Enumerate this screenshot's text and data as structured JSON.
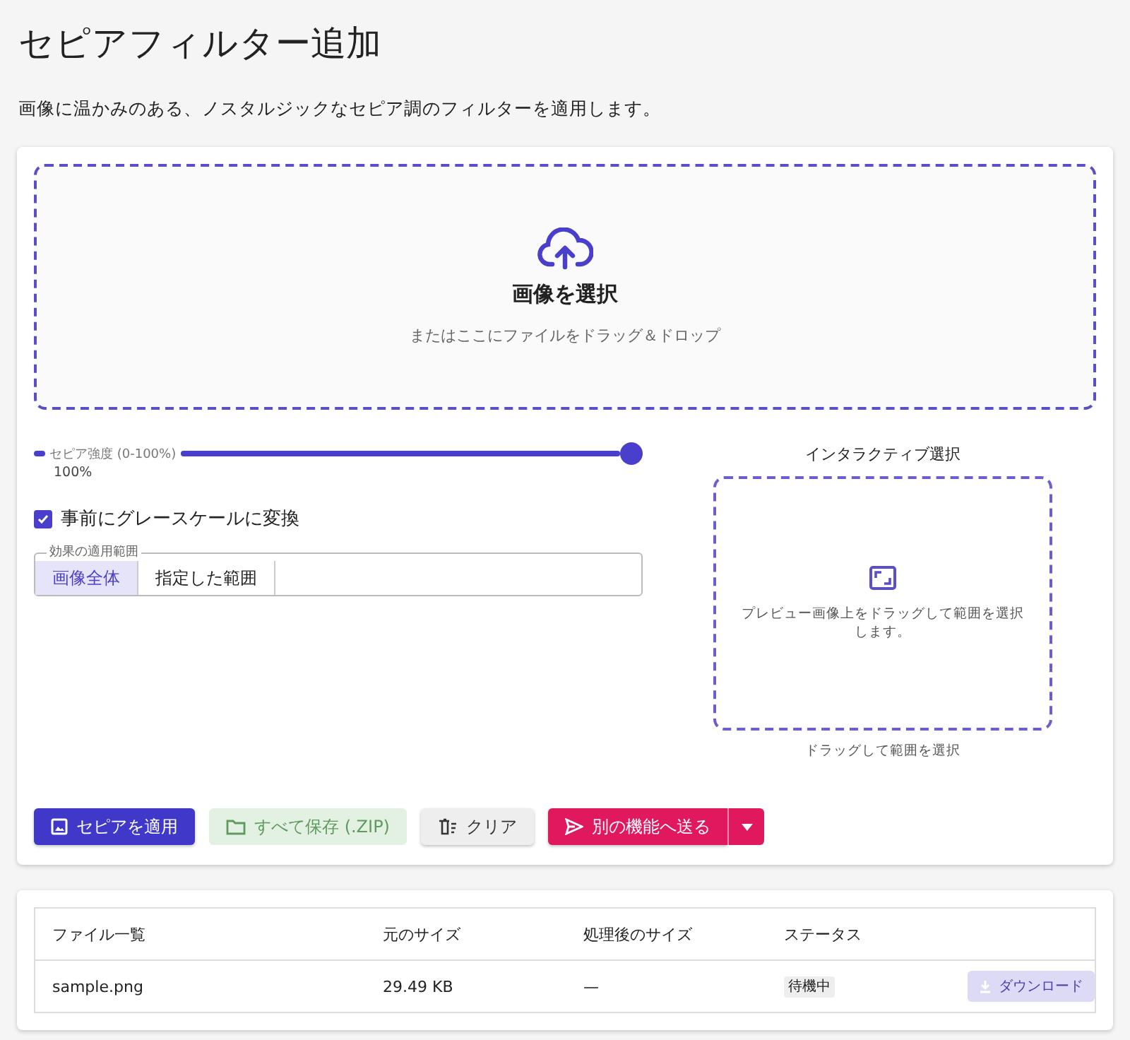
{
  "page": {
    "title": "セピアフィルター追加",
    "description": "画像に温かみのある、ノスタルジックなセピア調のフィルターを適用します。"
  },
  "dropzone": {
    "title": "画像を選択",
    "hint": "またはここにファイルをドラッグ＆ドロップ"
  },
  "slider": {
    "label": "セピア強度 (0-100%)",
    "level": 1.0,
    "reading": "100%"
  },
  "checkbox": {
    "label": "事前にグレースケールに変換",
    "checked": true
  },
  "scope": {
    "legend": "効果の適用範囲",
    "options": [
      {
        "label": "画像全体",
        "selected": true
      },
      {
        "label": "指定した範囲",
        "selected": false
      }
    ]
  },
  "interactive": {
    "title": "インタラクティブ選択",
    "message": "プレビュー画像上をドラッグして範囲を選択します。",
    "caption": "ドラッグして範囲を選択"
  },
  "buttons": [
    {
      "kind": "apply",
      "label": "セピアを適用",
      "disabled": false
    },
    {
      "kind": "zip",
      "label": "すべて保存 (.ZIP)",
      "disabled": true
    },
    {
      "kind": "clear",
      "label": "クリア",
      "disabled": false
    },
    {
      "kind": "send",
      "label": "別の機能へ送る",
      "disabled": false
    }
  ],
  "table": {
    "columns": [
      "ファイル一覧",
      "元のサイズ",
      "処理後のサイズ",
      "ステータス"
    ],
    "rows": [
      {
        "name": "sample.png",
        "original_size": "29.49 KB",
        "processed_size": "—",
        "status": "待機中",
        "action": "ダウンロード",
        "action_disabled": true
      }
    ]
  }
}
